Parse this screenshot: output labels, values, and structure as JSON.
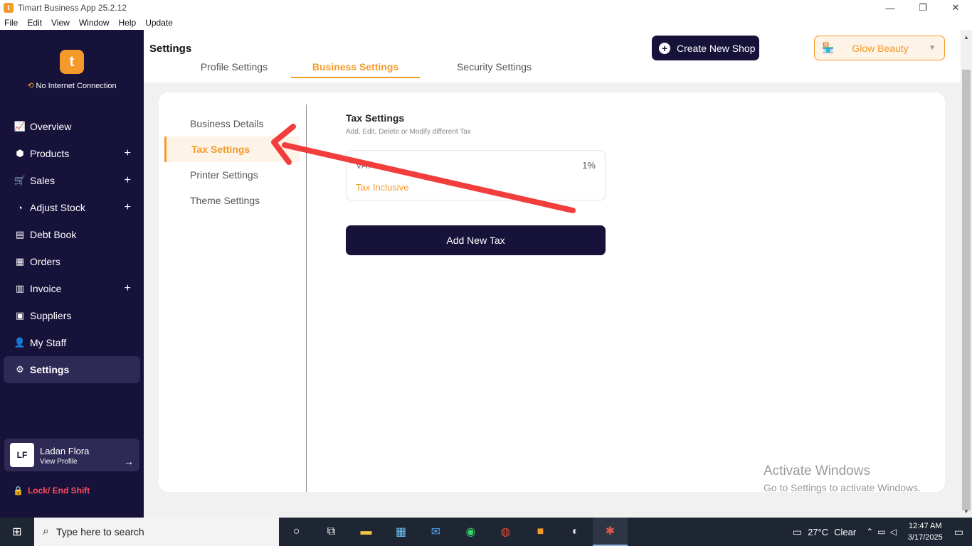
{
  "window": {
    "title": "Timart Business App 25.2.12",
    "logo_letter": "t",
    "minimize": "—",
    "restore": "❐",
    "close": "✕"
  },
  "menu": [
    "File",
    "Edit",
    "View",
    "Window",
    "Help",
    "Update"
  ],
  "sidebar": {
    "logo_letter": "t",
    "connection_status": "No Internet Connection",
    "items": [
      {
        "label": "Overview",
        "icon": "📈",
        "expandable": false,
        "active": false
      },
      {
        "label": "Products",
        "icon": "⬢",
        "expandable": true,
        "active": false
      },
      {
        "label": "Sales",
        "icon": "🛒",
        "expandable": true,
        "active": false
      },
      {
        "label": "Adjust Stock",
        "icon": "◔",
        "expandable": true,
        "active": false
      },
      {
        "label": "Debt Book",
        "icon": "▤",
        "expandable": false,
        "active": false
      },
      {
        "label": "Orders",
        "icon": "▦",
        "expandable": false,
        "active": false
      },
      {
        "label": "Invoice",
        "icon": "▥",
        "expandable": true,
        "active": false
      },
      {
        "label": "Suppliers",
        "icon": "▣",
        "expandable": false,
        "active": false
      },
      {
        "label": "My Staff",
        "icon": "👤",
        "expandable": false,
        "active": false
      },
      {
        "label": "Settings",
        "icon": "⚙",
        "expandable": false,
        "active": true
      }
    ],
    "expand_symbol": "+",
    "profile": {
      "initials": "LF",
      "name": "Ladan Flora",
      "link": "View Profile",
      "arrow": "→"
    },
    "lock_label": "Lock/ End Shift"
  },
  "header": {
    "page_title": "Settings",
    "tabs": [
      {
        "label": "Profile Settings",
        "active": false
      },
      {
        "label": "Business Settings",
        "active": true
      },
      {
        "label": "Security Settings",
        "active": false
      }
    ],
    "create_shop_label": "Create New Shop",
    "shop_name": "Glow Beauty"
  },
  "business_settings": {
    "submenu": [
      {
        "label": "Business Details",
        "active": false
      },
      {
        "label": "Tax Settings",
        "active": true
      },
      {
        "label": "Printer Settings",
        "active": false
      },
      {
        "label": "Theme Settings",
        "active": false
      }
    ],
    "tax_title": "Tax Settings",
    "tax_subtitle": "Add, Edit, Delete or Modify different Tax",
    "taxes": [
      {
        "name": "VAT",
        "rate": "1%",
        "type": "Tax Inclusive"
      }
    ],
    "add_tax_label": "Add New Tax"
  },
  "watermark": {
    "title": "Activate Windows",
    "subtitle": "Go to Settings to activate Windows."
  },
  "annotation": {
    "color": "#f23d3d"
  },
  "taskbar": {
    "search_placeholder": "Type here to search",
    "apps": [
      "cortana-icon",
      "task-view-icon",
      "file-explorer-icon",
      "store-icon",
      "mail-icon",
      "whatsapp-icon",
      "chrome-icon",
      "timart-icon",
      "paint-icon",
      "app-icon"
    ],
    "temperature": "27°C",
    "weather": "Clear",
    "time": "12:47 AM",
    "date": "3/17/2025"
  },
  "colors": {
    "accent": "#f39a2b",
    "sidebar_bg": "#16123a",
    "danger": "#ff4b5c"
  }
}
